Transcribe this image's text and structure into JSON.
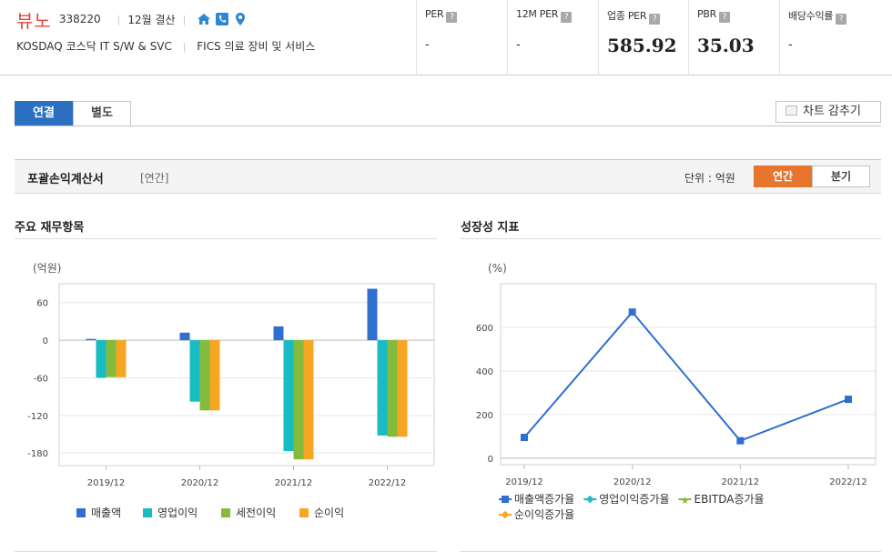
{
  "header": {
    "company_name": "뷰노",
    "code": "338220",
    "settlement": "12월 결산",
    "market_line": "KOSDAQ  코스닥 IT S/W & SVC",
    "sector_line": "FICS 의료 장비 및 서비스",
    "icons": [
      "home-icon",
      "phone-icon",
      "location-pin-icon"
    ]
  },
  "metrics": [
    {
      "label": "PER",
      "value": "-"
    },
    {
      "label": "12M PER",
      "value": "-"
    },
    {
      "label": "업종 PER",
      "value": "585.92"
    },
    {
      "label": "PBR",
      "value": "35.03"
    },
    {
      "label": "배당수익률",
      "value": "-"
    }
  ],
  "tabs": {
    "consolidated": "연결",
    "separate": "별도"
  },
  "hide_chart_label": "차트 감추기",
  "section": {
    "title": "포괄손익계산서",
    "subtitle": "[연간]",
    "unit_label": "단위 : 억원",
    "annual_label": "연간",
    "quarter_label": "분기"
  },
  "left_panel": {
    "title": "주요 재무항목"
  },
  "right_panel": {
    "title": "성장성 지표"
  },
  "colors": {
    "brand_red": "#e0483a",
    "tab_blue": "#2b6fc1",
    "toggle_orange": "#e8752e"
  },
  "chart_data": [
    {
      "type": "bar",
      "title": "",
      "ylabel": "(억원)",
      "categories": [
        "2019/12",
        "2020/12",
        "2021/12",
        "2022/12"
      ],
      "ylim": [
        -200,
        90
      ],
      "yticks": [
        60,
        0,
        -60,
        -120,
        -180
      ],
      "series": [
        {
          "name": "매출액",
          "color": "#2f6fcf",
          "values": [
            2,
            12,
            22,
            82
          ]
        },
        {
          "name": "영업이익",
          "color": "#19bcc3",
          "values": [
            -60,
            -98,
            -177,
            -152
          ]
        },
        {
          "name": "세전이익",
          "color": "#85bb3c",
          "values": [
            -59,
            -112,
            -190,
            -154
          ]
        },
        {
          "name": "순이익",
          "color": "#f6a623",
          "values": [
            -59,
            -112,
            -190,
            -154
          ]
        }
      ],
      "grid": true,
      "legend": "bottom"
    },
    {
      "type": "line",
      "title": "",
      "ylabel": "(%)",
      "categories": [
        "2019/12",
        "2020/12",
        "2021/12",
        "2022/12"
      ],
      "ylim": [
        -30,
        800
      ],
      "yticks": [
        600,
        400,
        200,
        0
      ],
      "series": [
        {
          "name": "매출액증가율",
          "color": "#2f6fcf",
          "marker": "square",
          "values": [
            95,
            670,
            80,
            270
          ]
        },
        {
          "name": "영업이익증가율",
          "color": "#19bcc3",
          "marker": "diamond",
          "values": []
        },
        {
          "name": "EBITDA증가율",
          "color": "#85bb3c",
          "marker": "star",
          "values": []
        },
        {
          "name": "순이익증가율",
          "color": "#f6a623",
          "marker": "diamond",
          "values": []
        }
      ],
      "grid": true,
      "legend": "bottom"
    }
  ]
}
